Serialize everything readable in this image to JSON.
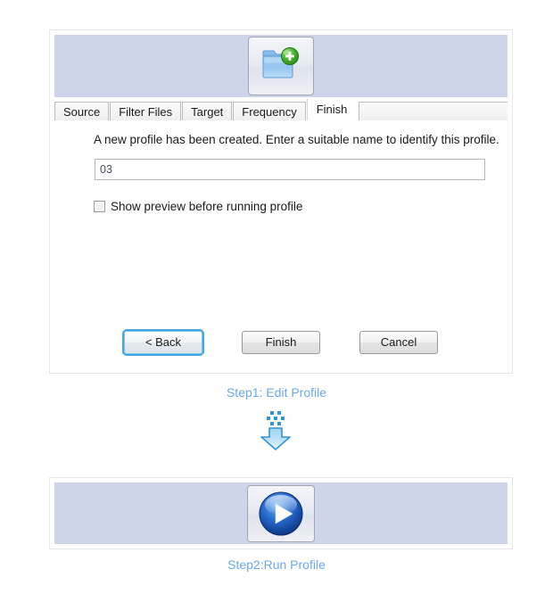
{
  "step1": {
    "header_icon": "new-folder-icon",
    "tabs": [
      {
        "label": "Source",
        "active": false
      },
      {
        "label": "Filter Files",
        "active": false
      },
      {
        "label": "Target",
        "active": false
      },
      {
        "label": "Frequency",
        "active": false
      },
      {
        "label": "Finish",
        "active": true
      }
    ],
    "instruction": "A new profile has been created. Enter a suitable name to identify this profile.",
    "profile_name_input": {
      "value": "03",
      "placeholder": ""
    },
    "preview_checkbox": {
      "label": "Show preview before running profile",
      "checked": false
    },
    "buttons": {
      "back": "< Back",
      "finish": "Finish",
      "cancel": "Cancel"
    },
    "caption": "Step1: Edit Profile"
  },
  "flow": {
    "arrow_icon": "download-arrow-icon"
  },
  "step2": {
    "header_icon": "play-button-icon",
    "caption": "Step2:Run Profile"
  },
  "colors": {
    "banner": "#ced4e9",
    "caption_text": "#6aa9ef",
    "focus_ring": "#3fa9e0",
    "accent_green": "#3fa62c",
    "accent_blue": "#1b5fc0"
  }
}
